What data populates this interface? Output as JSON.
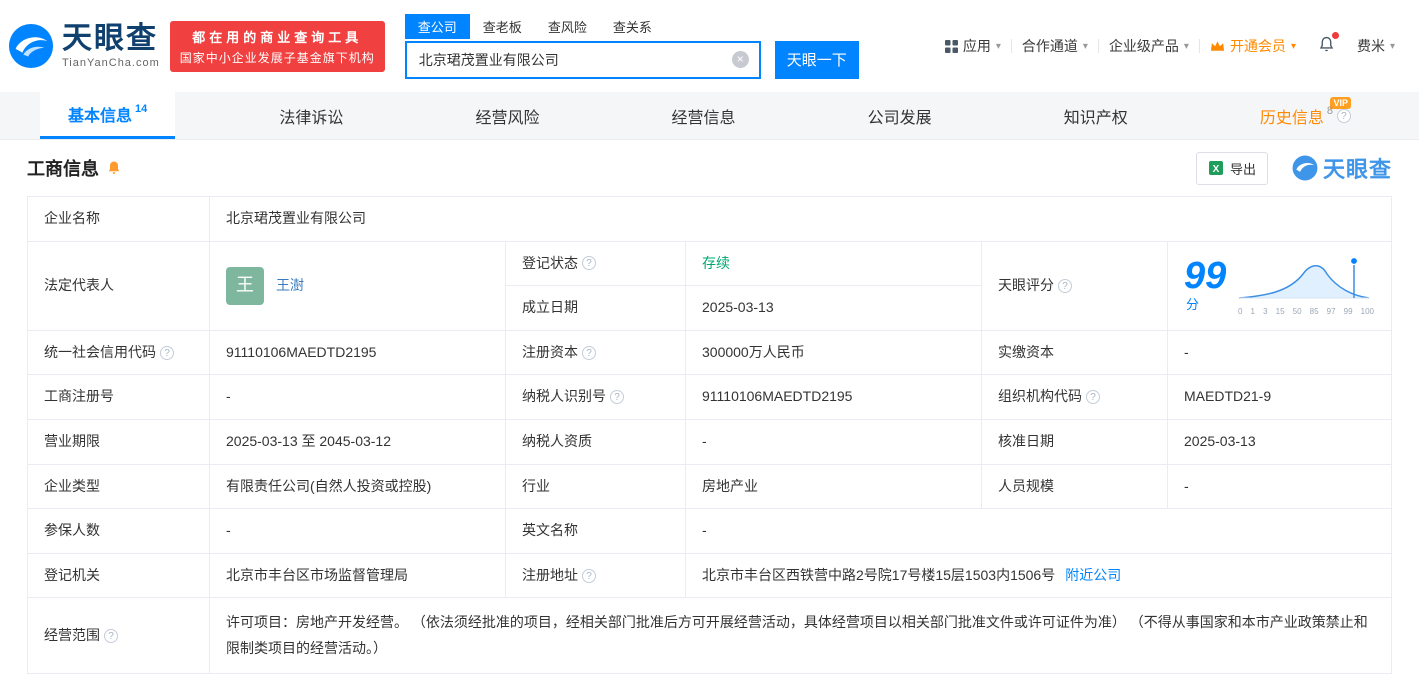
{
  "icons": {
    "question": "?",
    "caret": "▾",
    "clear": "×",
    "excel": "X"
  },
  "brand": {
    "logo_cn": "天眼查",
    "logo_en": "TianYanCha.com",
    "slogan_line1": "都在用的商业查询工具",
    "slogan_line2": "国家中小企业发展子基金旗下机构"
  },
  "search": {
    "tab_company": "查公司",
    "tab_boss": "查老板",
    "tab_risk": "查风险",
    "tab_relation": "查关系",
    "input_value": "北京珺茂置业有限公司",
    "button_label": "天眼一下"
  },
  "topnav": {
    "apps": "应用",
    "partner": "合作通道",
    "enterprise": "企业级产品",
    "vip": "开通会员",
    "user": "费米"
  },
  "tabs": {
    "basic": "基本信息",
    "basic_count": "14",
    "legal": "法律诉讼",
    "risk": "经营风险",
    "operation": "经营信息",
    "development": "公司发展",
    "ip": "知识产权",
    "history": "历史信息",
    "history_count": "8",
    "history_vip": "VIP"
  },
  "section": {
    "title": "工商信息",
    "export_label": "导出",
    "watermark": "天眼查"
  },
  "table": {
    "company_name_label": "企业名称",
    "company_name": "北京珺茂置业有限公司",
    "legal_rep_label": "法定代表人",
    "legal_rep_avatar": "王",
    "legal_rep_name": "王澍",
    "reg_status_label": "登记状态",
    "reg_status": "存续",
    "establish_date_label": "成立日期",
    "establish_date": "2025-03-13",
    "score_label": "天眼评分",
    "score_value": "99",
    "score_unit": "分",
    "score_ticks": [
      "0",
      "1",
      "3",
      "15",
      "50",
      "85",
      "97",
      "99",
      "100"
    ],
    "credit_code_label": "统一社会信用代码",
    "credit_code": "91110106MAEDTD2195",
    "reg_capital_label": "注册资本",
    "reg_capital": "300000万人民币",
    "paid_capital_label": "实缴资本",
    "paid_capital": "-",
    "reg_number_label": "工商注册号",
    "reg_number": "-",
    "taxpayer_id_label": "纳税人识别号",
    "taxpayer_id": "91110106MAEDTD2195",
    "org_code_label": "组织机构代码",
    "org_code": "MAEDTD21-9",
    "business_term_label": "营业期限",
    "business_term": "2025-03-13 至 2045-03-12",
    "taxpayer_quality_label": "纳税人资质",
    "taxpayer_quality": "-",
    "approval_date_label": "核准日期",
    "approval_date": "2025-03-13",
    "company_type_label": "企业类型",
    "company_type": "有限责任公司(自然人投资或控股)",
    "industry_label": "行业",
    "industry": "房地产业",
    "staff_size_label": "人员规模",
    "staff_size": "-",
    "insured_label": "参保人数",
    "insured": "-",
    "english_name_label": "英文名称",
    "english_name": "-",
    "reg_authority_label": "登记机关",
    "reg_authority": "北京市丰台区市场监督管理局",
    "reg_address_label": "注册地址",
    "reg_address": "北京市丰台区西铁营中路2号院17号楼15层1503内1506号",
    "nearby_link": "附近公司",
    "business_scope_label": "经营范围",
    "business_scope": "许可项目：房地产开发经营。 （依法须经批准的项目，经相关部门批准后方可开展经营活动，具体经营项目以相关部门批准文件或许可证件为准） （不得从事国家和本市产业政策禁止和限制类项目的经营活动。）"
  }
}
